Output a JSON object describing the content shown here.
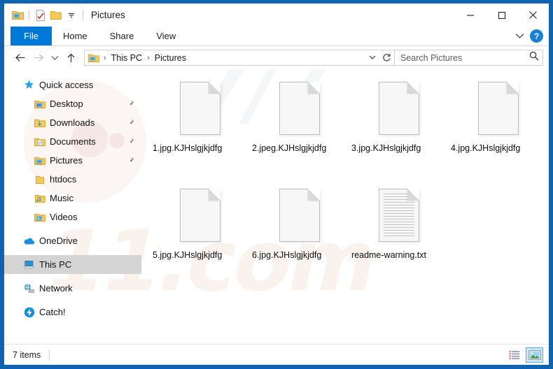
{
  "window": {
    "title": "Pictures",
    "quick_access_toolbar": [
      {
        "name": "pictures-folder-icon",
        "label": "Pictures"
      },
      {
        "name": "properties-icon",
        "label": "Properties"
      },
      {
        "name": "new-folder-icon",
        "label": "New folder"
      },
      {
        "name": "customize-dropdown-icon",
        "label": "Customize Quick Access Toolbar"
      }
    ],
    "controls": {
      "minimize": "Minimize",
      "maximize": "Maximize",
      "close": "Close"
    }
  },
  "ribbon": {
    "tabs": [
      {
        "label": "File",
        "active": true
      },
      {
        "label": "Home",
        "active": false
      },
      {
        "label": "Share",
        "active": false
      },
      {
        "label": "View",
        "active": false
      }
    ],
    "expand_label": "Expand the Ribbon",
    "help_label": "?"
  },
  "address": {
    "back_label": "Back",
    "forward_label": "Forward",
    "recent_label": "Recent locations",
    "up_label": "Up",
    "breadcrumbs": [
      "This PC",
      "Pictures"
    ],
    "separator": "›",
    "refresh_label": "Refresh"
  },
  "search": {
    "placeholder": "Search Pictures",
    "value": "",
    "icon": "search-icon"
  },
  "sidebar": {
    "items": [
      {
        "label": "Quick access",
        "icon": "star-icon",
        "level": 0,
        "pinned": false,
        "selected": false
      },
      {
        "label": "Desktop",
        "icon": "folder-desktop-icon",
        "level": 1,
        "pinned": true,
        "selected": false
      },
      {
        "label": "Downloads",
        "icon": "folder-downloads-icon",
        "level": 1,
        "pinned": true,
        "selected": false
      },
      {
        "label": "Documents",
        "icon": "folder-documents-icon",
        "level": 1,
        "pinned": true,
        "selected": false
      },
      {
        "label": "Pictures",
        "icon": "folder-pictures-icon",
        "level": 1,
        "pinned": true,
        "selected": false
      },
      {
        "label": "htdocs",
        "icon": "folder-icon",
        "level": 1,
        "pinned": false,
        "selected": false
      },
      {
        "label": "Music",
        "icon": "folder-music-icon",
        "level": 1,
        "pinned": false,
        "selected": false
      },
      {
        "label": "Videos",
        "icon": "folder-videos-icon",
        "level": 1,
        "pinned": false,
        "selected": false
      },
      {
        "label": "OneDrive",
        "icon": "cloud-icon",
        "level": 0,
        "pinned": false,
        "selected": false,
        "gap_before": true
      },
      {
        "label": "This PC",
        "icon": "computer-icon",
        "level": 0,
        "pinned": false,
        "selected": true,
        "gap_before": true
      },
      {
        "label": "Network",
        "icon": "network-icon",
        "level": 0,
        "pinned": false,
        "selected": false,
        "gap_before": true
      },
      {
        "label": "Catch!",
        "icon": "catch-icon",
        "level": 0,
        "pinned": false,
        "selected": false,
        "gap_before": true
      }
    ]
  },
  "files": [
    {
      "name": "1.jpg.KJHslgjkjdfg",
      "icon": "blank-file-icon"
    },
    {
      "name": "2.jpeg.KJHslgjkjdfg",
      "icon": "blank-file-icon"
    },
    {
      "name": "3.jpg.KJHslgjkjdfg",
      "icon": "blank-file-icon"
    },
    {
      "name": "4.jpg.KJHslgjkjdfg",
      "icon": "blank-file-icon"
    },
    {
      "name": "5.jpg.KJHslgjkjdfg",
      "icon": "blank-file-icon"
    },
    {
      "name": "6.jpg.KJHslgjkjdfg",
      "icon": "blank-file-icon"
    },
    {
      "name": "readme-warning.txt",
      "icon": "text-file-icon"
    }
  ],
  "statusbar": {
    "item_count": "7 items",
    "views": [
      {
        "name": "details-view-button",
        "label": "Details view",
        "active": false
      },
      {
        "name": "large-icons-view-button",
        "label": "Large icons view",
        "active": true
      }
    ]
  },
  "colors": {
    "window_border": "#1063ae",
    "accent": "#0078d7",
    "selected_row": "#d4d4d4",
    "view_active": "#cce8ff"
  }
}
